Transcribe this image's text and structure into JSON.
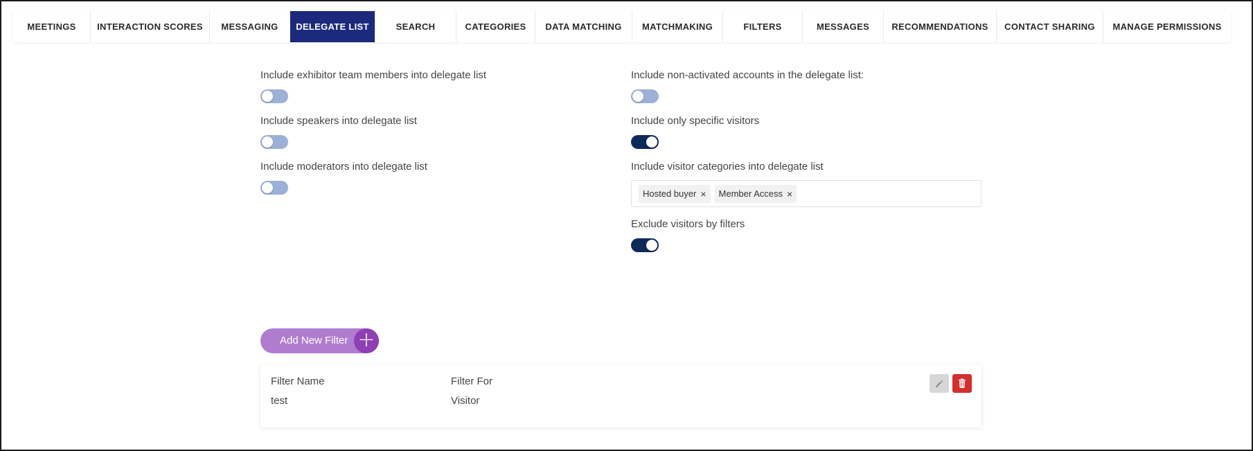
{
  "tabs": [
    {
      "label": "MEETINGS",
      "width": 112
    },
    {
      "label": "INTERACTION SCORES",
      "width": 172
    },
    {
      "label": "MESSAGING",
      "width": 116
    },
    {
      "label": "DELEGATE LIST",
      "width": 123,
      "active": true
    },
    {
      "label": "SEARCH",
      "width": 117
    },
    {
      "label": "CATEGORIES",
      "width": 114
    },
    {
      "label": "DATA MATCHING",
      "width": 140
    },
    {
      "label": "MATCHMAKING",
      "width": 131
    },
    {
      "label": "FILTERS",
      "width": 115
    },
    {
      "label": "MESSAGES",
      "width": 117
    },
    {
      "label": "RECOMMENDATIONS",
      "width": 163
    },
    {
      "label": "CONTACT SHARING",
      "width": 154
    },
    {
      "label": "MANAGE PERMISSIONS",
      "width": 184
    }
  ],
  "left_settings": {
    "exhibitor": {
      "label": "Include exhibitor team members into delegate list",
      "enabled": false
    },
    "speakers": {
      "label": "Include speakers into delegate list",
      "enabled": false
    },
    "moderators": {
      "label": "Include moderators into delegate list",
      "enabled": false
    }
  },
  "right_settings": {
    "non_activated": {
      "label": "Include non-activated accounts in the delegate list:",
      "enabled": false
    },
    "specific_visitors": {
      "label": "Include only specific visitors",
      "enabled": true
    },
    "visitor_categories": {
      "label": "Include visitor categories into delegate list",
      "chips": [
        "Hosted buyer",
        "Member Access"
      ],
      "chip_remove": "×"
    },
    "exclude_filters": {
      "label": "Exclude visitors by filters",
      "enabled": true
    }
  },
  "add_filter": {
    "label": "Add New Filter",
    "plus": "+"
  },
  "filter_table": {
    "headers": {
      "name": "Filter Name",
      "for": "Filter For"
    },
    "rows": [
      {
        "name": "test",
        "for": "Visitor"
      }
    ]
  },
  "colors": {
    "active_tab": "#1c2a7d",
    "toggle_on": "#0e2a5a",
    "toggle_off": "#9db1d6",
    "accent_purple": "#b07ccf",
    "danger": "#d32f2f"
  }
}
